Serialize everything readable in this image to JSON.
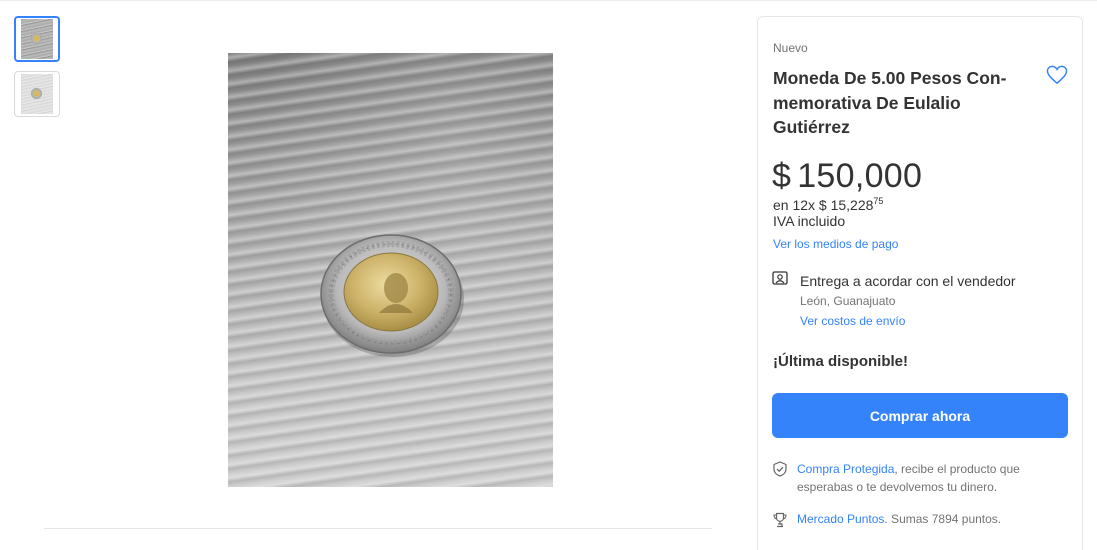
{
  "gallery": {
    "thumbnails": [
      {
        "label": "",
        "selected": true
      },
      {
        "label": "",
        "selected": false
      }
    ]
  },
  "product": {
    "condition": "Nuevo",
    "title": "Moneda De 5.00 Pesos Con-memorativa De Eulalio Gutiérrez",
    "currency": "$",
    "price": "150,000",
    "installments_prefix": "en 12x $ 15,228",
    "installments_cents": "75",
    "iva": "IVA incluido",
    "payment_link": "Ver los medios de pago",
    "favorite_icon": "heart-icon"
  },
  "delivery": {
    "icon": "delivery-person-icon",
    "title": "Entrega a acordar con el vendedor",
    "location": "León, Guanajuato",
    "link": "Ver costos de envío"
  },
  "stock": {
    "label": "¡Última disponible!"
  },
  "buy_button": {
    "label": "Comprar ahora",
    "color": "#3483fa"
  },
  "protection": {
    "icon": "shield-check-icon",
    "link": "Compra Protegida",
    "text": ", recibe el producto que esperabas o te devolvemos tu dinero."
  },
  "points": {
    "icon": "trophy-icon",
    "link": "Mercado Puntos",
    "text": ". Sumas 7894 puntos."
  }
}
